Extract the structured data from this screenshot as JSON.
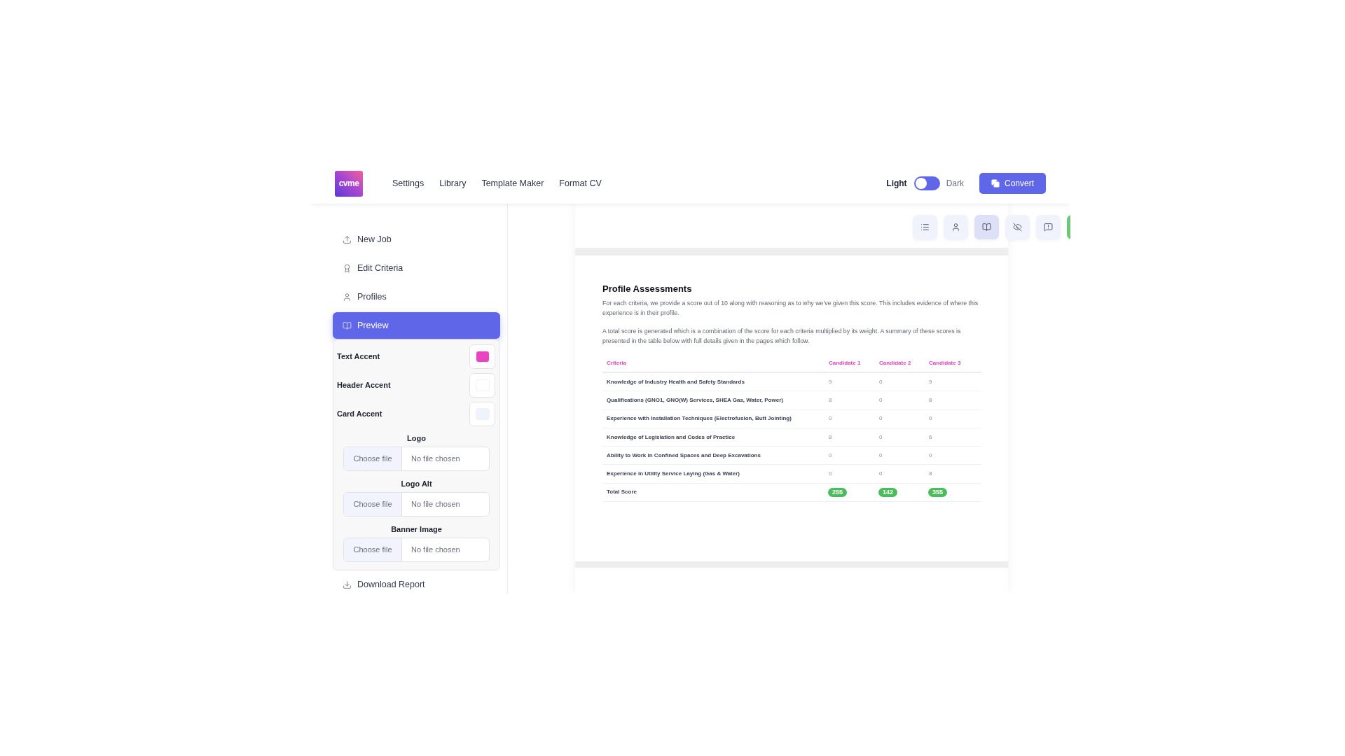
{
  "header": {
    "logo": "cvme",
    "nav": [
      "Settings",
      "Library",
      "Template Maker",
      "Format CV"
    ],
    "theme_switch": {
      "light_label": "Light",
      "dark_label": "Dark",
      "dark": false
    },
    "convert_button": "Convert"
  },
  "sidebar": {
    "items": [
      {
        "label": "New Job",
        "selected": false
      },
      {
        "label": "Edit Criteria",
        "selected": false
      },
      {
        "label": "Profiles",
        "selected": false
      },
      {
        "label": "Preview",
        "selected": true
      }
    ],
    "preview_settings": {
      "accents": [
        {
          "label": "Text Accent",
          "color": "#e844bf"
        },
        {
          "label": "Header Accent",
          "color": "#ffffff"
        },
        {
          "label": "Card Accent",
          "color": "#eff3fc"
        }
      ],
      "uploads": [
        {
          "label": "Logo",
          "button": "Choose file",
          "status": "No file chosen"
        },
        {
          "label": "Logo Alt",
          "button": "Choose file",
          "status": "No file chosen"
        },
        {
          "label": "Banner Image",
          "button": "Choose file",
          "status": "No file chosen"
        }
      ]
    },
    "footer_item": {
      "label": "Download Report"
    }
  },
  "view_toolbar": [
    {
      "selected": false
    },
    {
      "selected": false
    },
    {
      "selected": true
    },
    {
      "selected": false
    },
    {
      "selected": false
    }
  ],
  "report": {
    "title": "Profile Assessments",
    "paragraphs": [
      "For each criteria, we provide a score out of 10 along with reasoning as to why we’ve given this score. This includes evidence of where this experience is in their profile.",
      "A total score is generated which is a combination of the score for each criteria multiplied by its weight. A summary of these scores is presented in the table below with full details given in the pages which follow."
    ],
    "table": {
      "columns": [
        "Criteria",
        "Candidate 1",
        "Candidate 2",
        "Candidate 3"
      ],
      "rows": [
        {
          "kind": "score",
          "cells": [
            "Knowledge of Industry Health and Safety Standards",
            "9",
            "0",
            "9"
          ]
        },
        {
          "kind": "score",
          "cells": [
            "Qualifications (GNO1, GNO(W) Services, SHEA Gas, Water, Power)",
            "8",
            "0",
            "8"
          ]
        },
        {
          "kind": "score",
          "cells": [
            "Experience with Installation Techniques (Electrofusion, Butt Jointing)",
            "0",
            "0",
            "0"
          ]
        },
        {
          "kind": "score",
          "cells": [
            "Knowledge of Legislation and Codes of Practice",
            "8",
            "0",
            "6"
          ]
        },
        {
          "kind": "score",
          "cells": [
            "Ability to Work in Confined Spaces and Deep Excavations",
            "0",
            "0",
            "0"
          ]
        },
        {
          "kind": "score",
          "cells": [
            "Experience in Utility Service Laying (Gas & Water)",
            "0",
            "0",
            "8"
          ]
        },
        {
          "kind": "total",
          "cells": [
            "Total Score",
            "255",
            "142",
            "355"
          ]
        }
      ]
    }
  }
}
